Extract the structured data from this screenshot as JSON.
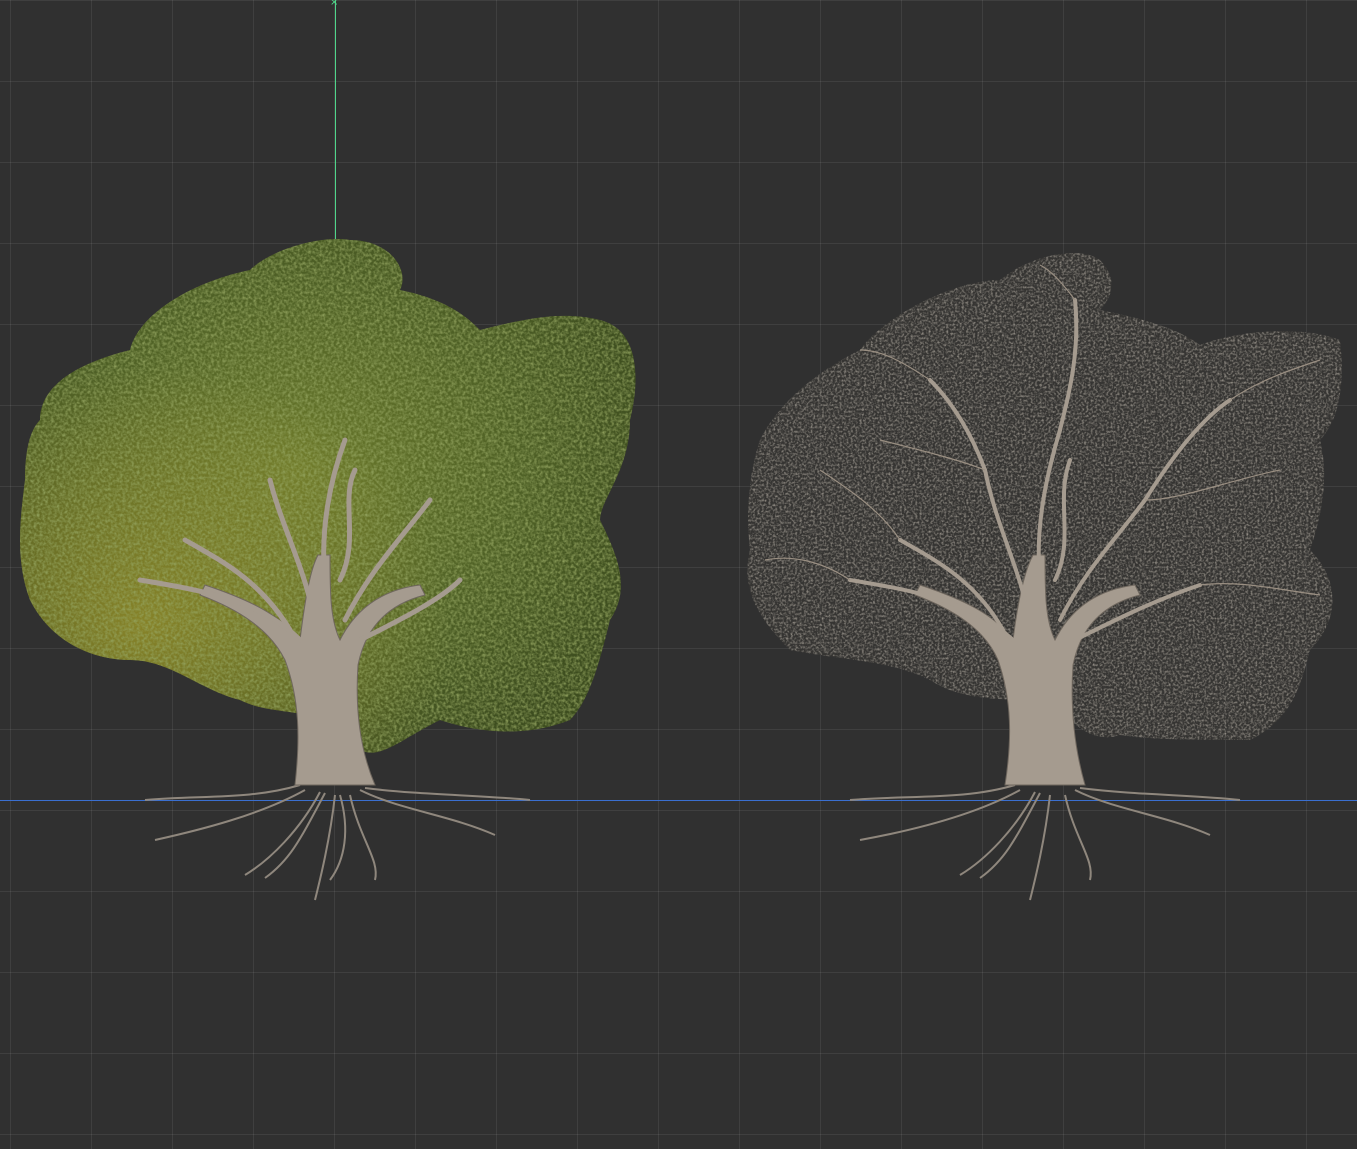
{
  "viewport": {
    "background_color": "#303030",
    "grid_color": "#3c3c3c",
    "axis_colors": {
      "y_axis": "#4fd68a",
      "x_axis": "#3a6fd0"
    }
  },
  "objects": [
    {
      "name": "tree-with-foliage",
      "foliage_color": "#5a6b2a",
      "foliage_highlight": "#8a8a2a",
      "bark_color": "#a89e92"
    },
    {
      "name": "tree-bare-branches",
      "twig_color": "#8a7e70",
      "bark_color": "#a89e92"
    }
  ]
}
